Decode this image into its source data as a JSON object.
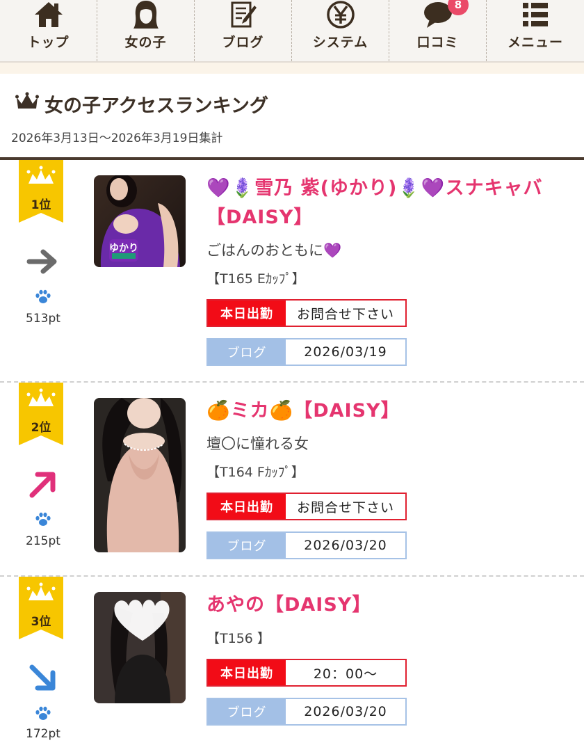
{
  "nav": {
    "items": [
      {
        "label": "トップ",
        "icon": "home-icon"
      },
      {
        "label": "女の子",
        "icon": "girl-icon"
      },
      {
        "label": "ブログ",
        "icon": "blog-icon"
      },
      {
        "label": "システム",
        "icon": "yen-icon"
      },
      {
        "label": "口コミ",
        "icon": "chat-icon",
        "badge": "8"
      },
      {
        "label": "メニュー",
        "icon": "menu-list-icon"
      }
    ]
  },
  "ranking": {
    "title": "女の子アクセスランキング",
    "period": "2026年3月13日～2026年3月19日集計"
  },
  "entries": [
    {
      "rank": "1位",
      "trend": "right",
      "points": "513pt",
      "name_line1": "💜🪻雪乃 紫(ゆかり)🪻💜スナキャバ",
      "name_line2": "【DAISY】",
      "desc": "ごはんのおともに💜",
      "spec": "【T165 Eｶｯﾌﾟ】",
      "work_label": "本日出勤",
      "work_value": "お問合せ下さい",
      "blog_label": "ブログ",
      "blog_date": "2026/03/19",
      "photo_tag": "ゆかり"
    },
    {
      "rank": "2位",
      "trend": "up",
      "points": "215pt",
      "name_line1": "🍊ミカ🍊【DAISY】",
      "desc": "壇〇に憧れる女",
      "spec": "【T164 Fｶｯﾌﾟ】",
      "work_label": "本日出勤",
      "work_value": "お問合せ下さい",
      "blog_label": "ブログ",
      "blog_date": "2026/03/20"
    },
    {
      "rank": "3位",
      "trend": "down",
      "points": "172pt",
      "name_line1": "あやの【DAISY】",
      "spec": "【T156 】",
      "work_label": "本日出勤",
      "work_value": "20：00～",
      "blog_label": "ブログ",
      "blog_date": "2026/03/20"
    }
  ],
  "colors": {
    "accent_pink": "#e5356f",
    "work_red": "#f20c17",
    "blog_blue": "#a3c0e6",
    "ribbon_yellow": "#f7c600",
    "trend_up": "#e0307a",
    "trend_down": "#3a86d8",
    "trend_flat": "#6b6b6b"
  }
}
